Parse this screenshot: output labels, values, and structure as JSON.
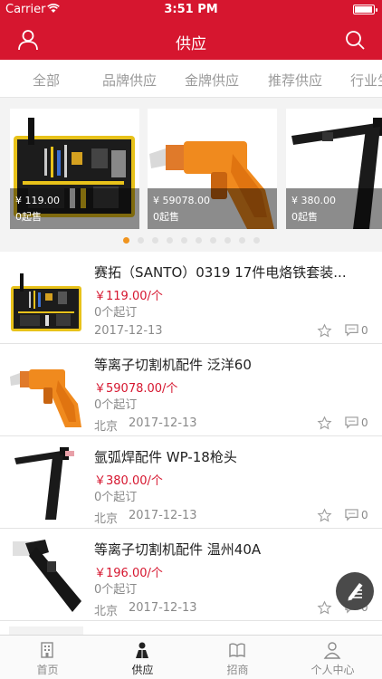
{
  "status_bar": {
    "carrier": "Carrier",
    "time": "3:51 PM",
    "battery_level": 0.95
  },
  "nav": {
    "title": "供应",
    "left_icon": "user-icon",
    "right_icon": "search-icon"
  },
  "category_tabs": [
    {
      "label": "全部"
    },
    {
      "label": "品牌供应"
    },
    {
      "label": "金牌供应"
    },
    {
      "label": "推荐供应"
    },
    {
      "label": "行业生"
    }
  ],
  "banner": {
    "slides": [
      {
        "price": "¥ 119.00",
        "moq": "0起售"
      },
      {
        "price": "¥ 59078.00",
        "moq": "0起售"
      },
      {
        "price": "¥ 380.00",
        "moq": "0起售"
      }
    ],
    "page_count": 10,
    "active_page": 1
  },
  "products": [
    {
      "name": "赛拓（SANTO）0319 17件电烙铁套装...",
      "price": "￥119.00/个",
      "moq": "0个起订",
      "location": "",
      "date": "2017-12-13",
      "comments": "0"
    },
    {
      "name": "等离子切割机配件 泛洋60",
      "price": "￥59078.00/个",
      "moq": "0个起订",
      "location": "北京",
      "date": "2017-12-13",
      "comments": "0"
    },
    {
      "name": "氩弧焊配件 WP-18枪头",
      "price": "￥380.00/个",
      "moq": "0个起订",
      "location": "北京",
      "date": "2017-12-13",
      "comments": "0"
    },
    {
      "name": "等离子切割机配件 温州40A",
      "price": "￥196.00/个",
      "moq": "0个起订",
      "location": "北京",
      "date": "2017-12-13",
      "comments": "0"
    }
  ],
  "fab_icon": "edit-icon",
  "tab_bar": [
    {
      "label": "首页",
      "icon": "building-icon",
      "active": false
    },
    {
      "label": "供应",
      "icon": "supply-person-icon",
      "active": true
    },
    {
      "label": "招商",
      "icon": "book-icon",
      "active": false
    },
    {
      "label": "个人中心",
      "icon": "profile-icon",
      "active": false
    }
  ],
  "colors": {
    "brand_red": "#d6162f",
    "active_dot": "#f0941e",
    "price_red": "#d6162f"
  }
}
